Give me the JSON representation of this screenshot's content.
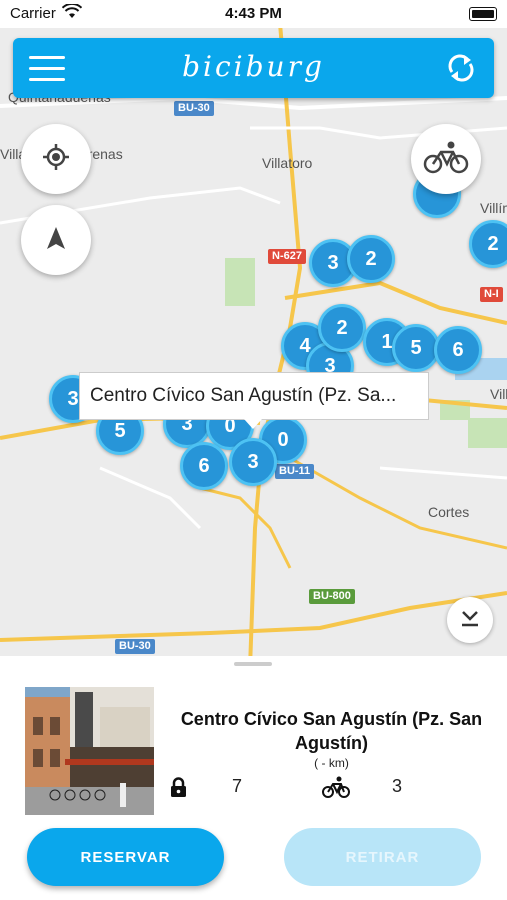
{
  "status_bar": {
    "carrier": "Carrier",
    "time": "4:43 PM"
  },
  "app_bar": {
    "logo": "biciburg"
  },
  "map": {
    "places": [
      "Quintanadueñas",
      "Villagonzalo Arenas",
      "Villatoro",
      "Villímar",
      "Villafría",
      "Cortes"
    ],
    "roads": [
      "BU-30",
      "N-627",
      "N-I",
      "BU-800",
      "BU-30",
      "BU-11"
    ],
    "clusters": [
      "3",
      "2",
      "3",
      "2",
      "4",
      "3",
      "1",
      "5",
      "6",
      "2",
      "3",
      "5",
      "3",
      "0",
      "0",
      "6",
      "3"
    ],
    "callout": "Centro Cívico San Agustín (Pz. Sa..."
  },
  "station": {
    "name": "Centro Cívico San Agustín (Pz. San Agustín)",
    "distance": "( - km)",
    "locks": "7",
    "bikes": "3"
  },
  "actions": {
    "reserve": "RESERVAR",
    "withdraw": "RETIRAR"
  },
  "colors": {
    "accent": "#0aa7ec",
    "cluster": "#2795d8"
  }
}
